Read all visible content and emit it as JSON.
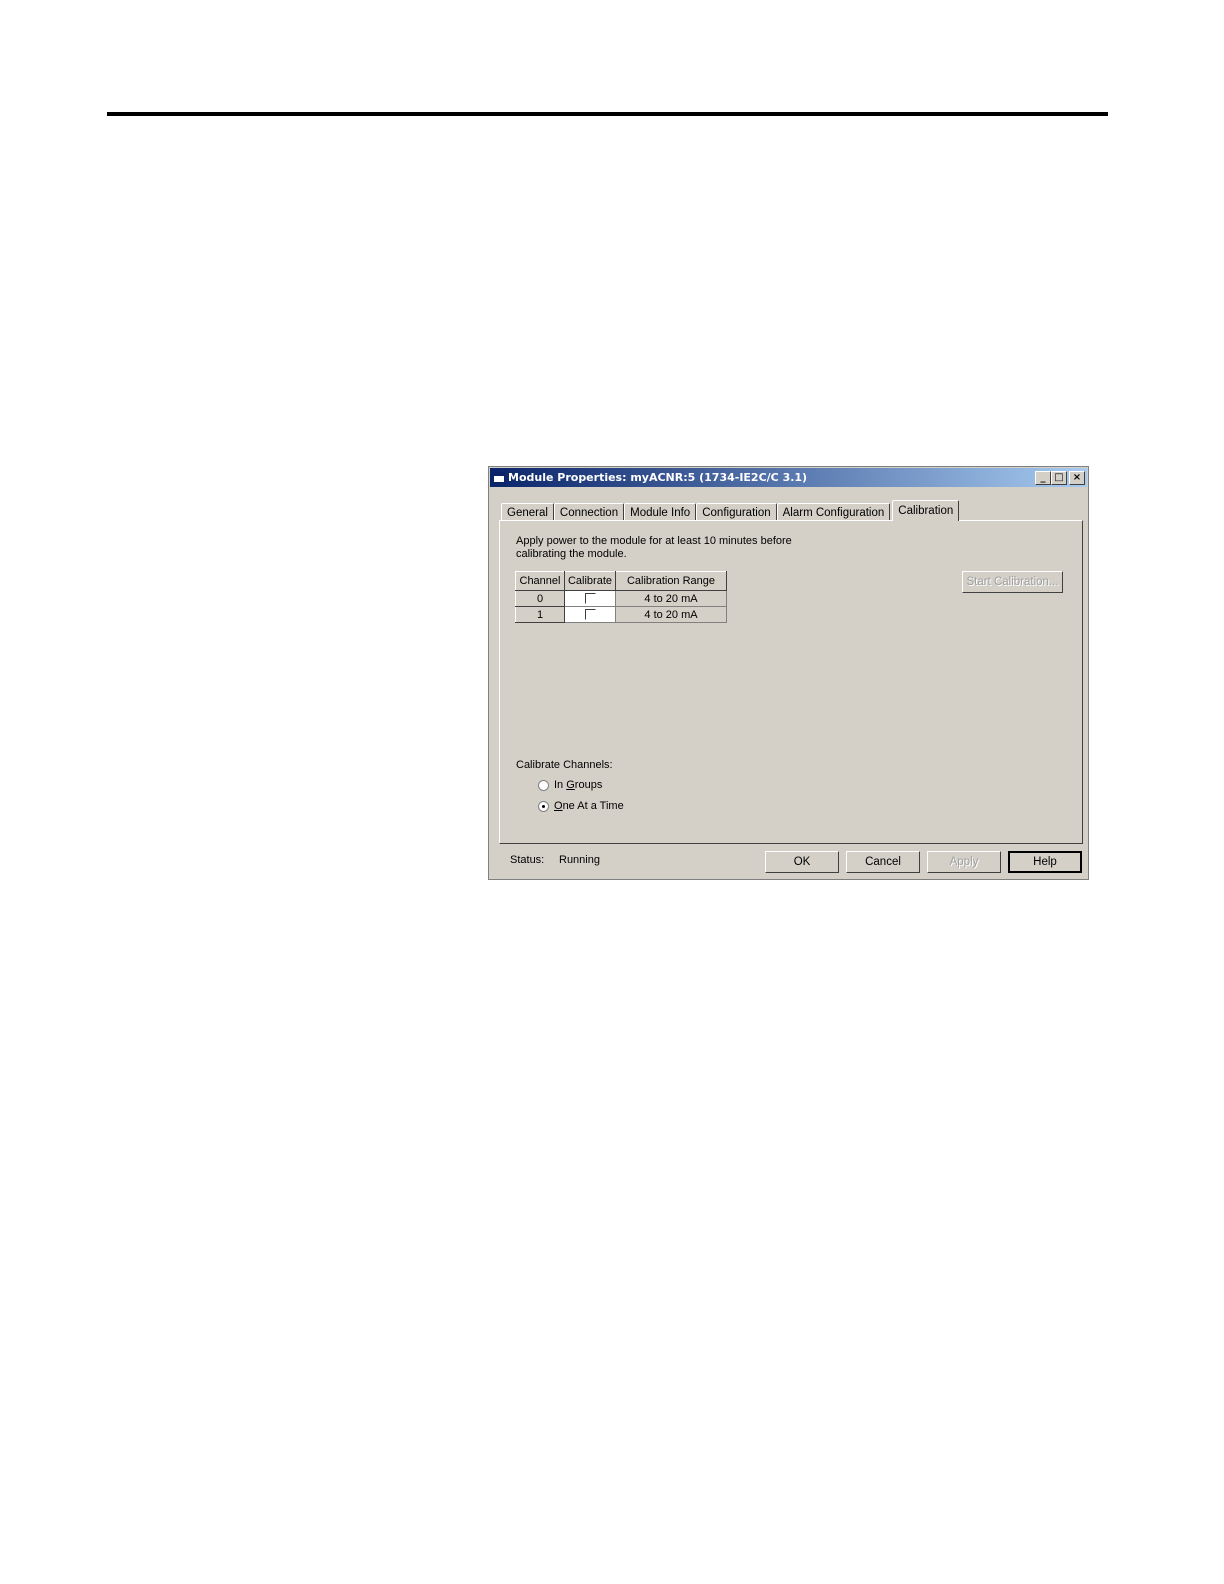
{
  "window": {
    "title": "Module Properties: myACNR:5 (1734-IE2C/C 3.1)",
    "minimize_glyph": "_",
    "maximize_glyph": "□",
    "close_glyph": "×"
  },
  "tabs": [
    {
      "label": "General"
    },
    {
      "label": "Connection"
    },
    {
      "label": "Module Info"
    },
    {
      "label": "Configuration"
    },
    {
      "label": "Alarm Configuration"
    },
    {
      "label": "Calibration",
      "active": true
    }
  ],
  "calibration": {
    "info_line1": "Apply power to the module for at least 10 minutes before",
    "info_line2": "calibrating the module.",
    "table": {
      "headers": [
        "Channel",
        "Calibrate",
        "Calibration Range"
      ],
      "rows": [
        {
          "channel": "0",
          "calibrate": false,
          "range": "4 to 20 mA"
        },
        {
          "channel": "1",
          "calibrate": false,
          "range": "4 to 20 mA"
        }
      ]
    },
    "start_button": "Start Calibration...",
    "channels_label": "Calibrate Channels:",
    "options": [
      {
        "label_pre": "In ",
        "label_mnemonic": "G",
        "label_post": "roups",
        "selected": false
      },
      {
        "label_pre": "",
        "label_mnemonic": "O",
        "label_post": "ne At a Time",
        "selected": true
      }
    ]
  },
  "footer": {
    "status_label": "Status:",
    "status_value": "Running",
    "ok": "OK",
    "cancel": "Cancel",
    "apply": "Apply",
    "help": "Help"
  }
}
